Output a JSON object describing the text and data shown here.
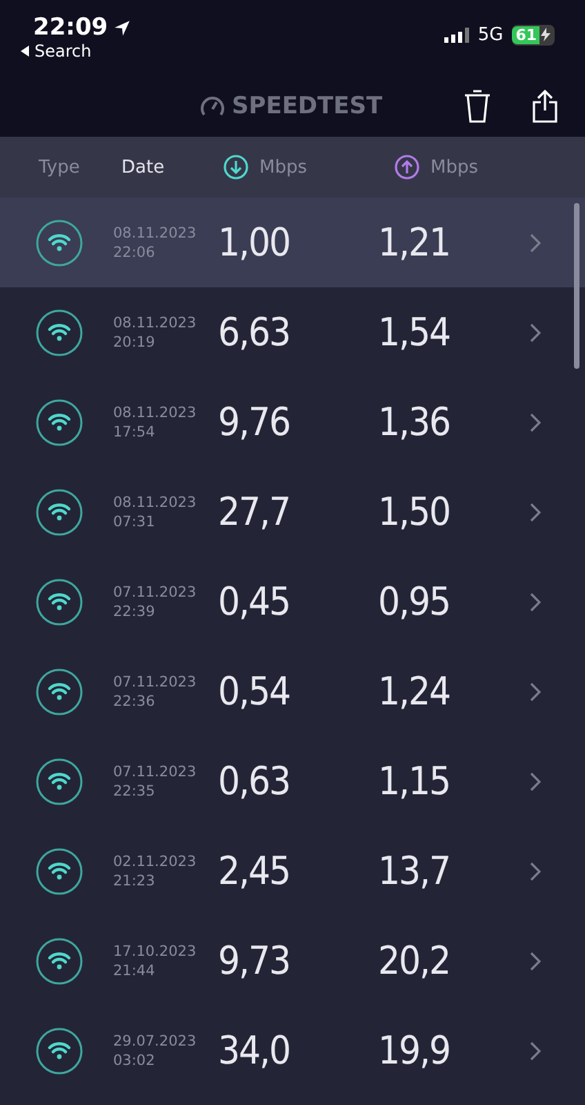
{
  "status_bar": {
    "time": "22:09",
    "back": "Search",
    "network": "5G",
    "battery": "61"
  },
  "header": {
    "title": "SPEEDTEST"
  },
  "columns": {
    "type": "Type",
    "date": "Date",
    "download": "Mbps",
    "upload": "Mbps"
  },
  "rows": [
    {
      "date": "08.11.2023",
      "time": "22:06",
      "download": "1,00",
      "upload": "1,21",
      "selected": true
    },
    {
      "date": "08.11.2023",
      "time": "20:19",
      "download": "6,63",
      "upload": "1,54",
      "selected": false
    },
    {
      "date": "08.11.2023",
      "time": "17:54",
      "download": "9,76",
      "upload": "1,36",
      "selected": false
    },
    {
      "date": "08.11.2023",
      "time": "07:31",
      "download": "27,7",
      "upload": "1,50",
      "selected": false
    },
    {
      "date": "07.11.2023",
      "time": "22:39",
      "download": "0,45",
      "upload": "0,95",
      "selected": false
    },
    {
      "date": "07.11.2023",
      "time": "22:36",
      "download": "0,54",
      "upload": "1,24",
      "selected": false
    },
    {
      "date": "07.11.2023",
      "time": "22:35",
      "download": "0,63",
      "upload": "1,15",
      "selected": false
    },
    {
      "date": "02.11.2023",
      "time": "21:23",
      "download": "2,45",
      "upload": "13,7",
      "selected": false
    },
    {
      "date": "17.10.2023",
      "time": "21:44",
      "download": "9,73",
      "upload": "20,2",
      "selected": false
    },
    {
      "date": "29.07.2023",
      "time": "03:02",
      "download": "34,0",
      "upload": "19,9",
      "selected": false
    }
  ]
}
